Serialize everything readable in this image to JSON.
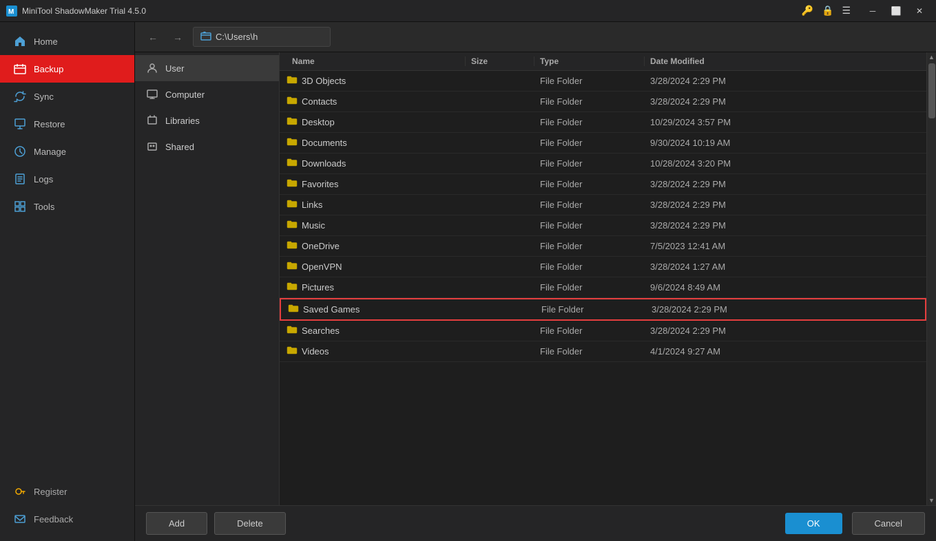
{
  "titlebar": {
    "title": "MiniTool ShadowMaker Trial 4.5.0"
  },
  "sidebar": {
    "items": [
      {
        "id": "home",
        "label": "Home",
        "icon": "home"
      },
      {
        "id": "backup",
        "label": "Backup",
        "icon": "backup",
        "active": true
      },
      {
        "id": "sync",
        "label": "Sync",
        "icon": "sync"
      },
      {
        "id": "restore",
        "label": "Restore",
        "icon": "restore"
      },
      {
        "id": "manage",
        "label": "Manage",
        "icon": "manage"
      },
      {
        "id": "logs",
        "label": "Logs",
        "icon": "logs"
      },
      {
        "id": "tools",
        "label": "Tools",
        "icon": "tools"
      }
    ],
    "bottom": [
      {
        "id": "register",
        "label": "Register",
        "icon": "key"
      },
      {
        "id": "feedback",
        "label": "Feedback",
        "icon": "mail"
      }
    ]
  },
  "toolbar": {
    "path": "C:\\Users\\h"
  },
  "tree": {
    "items": [
      {
        "id": "user",
        "label": "User",
        "selected": true
      },
      {
        "id": "computer",
        "label": "Computer"
      },
      {
        "id": "libraries",
        "label": "Libraries"
      },
      {
        "id": "shared",
        "label": "Shared"
      }
    ]
  },
  "file_list": {
    "columns": [
      {
        "id": "name",
        "label": "Name"
      },
      {
        "id": "size",
        "label": "Size"
      },
      {
        "id": "type",
        "label": "Type"
      },
      {
        "id": "date",
        "label": "Date Modified"
      }
    ],
    "rows": [
      {
        "name": "3D Objects",
        "size": "",
        "type": "File Folder",
        "date": "3/28/2024 2:29 PM",
        "highlighted": false
      },
      {
        "name": "Contacts",
        "size": "",
        "type": "File Folder",
        "date": "3/28/2024 2:29 PM",
        "highlighted": false
      },
      {
        "name": "Desktop",
        "size": "",
        "type": "File Folder",
        "date": "10/29/2024 3:57 PM",
        "highlighted": false
      },
      {
        "name": "Documents",
        "size": "",
        "type": "File Folder",
        "date": "9/30/2024 10:19 AM",
        "highlighted": false
      },
      {
        "name": "Downloads",
        "size": "",
        "type": "File Folder",
        "date": "10/28/2024 3:20 PM",
        "highlighted": false
      },
      {
        "name": "Favorites",
        "size": "",
        "type": "File Folder",
        "date": "3/28/2024 2:29 PM",
        "highlighted": false
      },
      {
        "name": "Links",
        "size": "",
        "type": "File Folder",
        "date": "3/28/2024 2:29 PM",
        "highlighted": false
      },
      {
        "name": "Music",
        "size": "",
        "type": "File Folder",
        "date": "3/28/2024 2:29 PM",
        "highlighted": false
      },
      {
        "name": "OneDrive",
        "size": "",
        "type": "File Folder",
        "date": "7/5/2023 12:41 AM",
        "highlighted": false
      },
      {
        "name": "OpenVPN",
        "size": "",
        "type": "File Folder",
        "date": "3/28/2024 1:27 AM",
        "highlighted": false
      },
      {
        "name": "Pictures",
        "size": "",
        "type": "File Folder",
        "date": "9/6/2024 8:49 AM",
        "highlighted": false
      },
      {
        "name": "Saved Games",
        "size": "",
        "type": "File Folder",
        "date": "3/28/2024 2:29 PM",
        "highlighted": true
      },
      {
        "name": "Searches",
        "size": "",
        "type": "File Folder",
        "date": "3/28/2024 2:29 PM",
        "highlighted": false
      },
      {
        "name": "Videos",
        "size": "",
        "type": "File Folder",
        "date": "4/1/2024 9:27 AM",
        "highlighted": false
      }
    ]
  },
  "bottom_bar": {
    "add_label": "Add",
    "delete_label": "Delete",
    "ok_label": "OK",
    "cancel_label": "Cancel"
  }
}
